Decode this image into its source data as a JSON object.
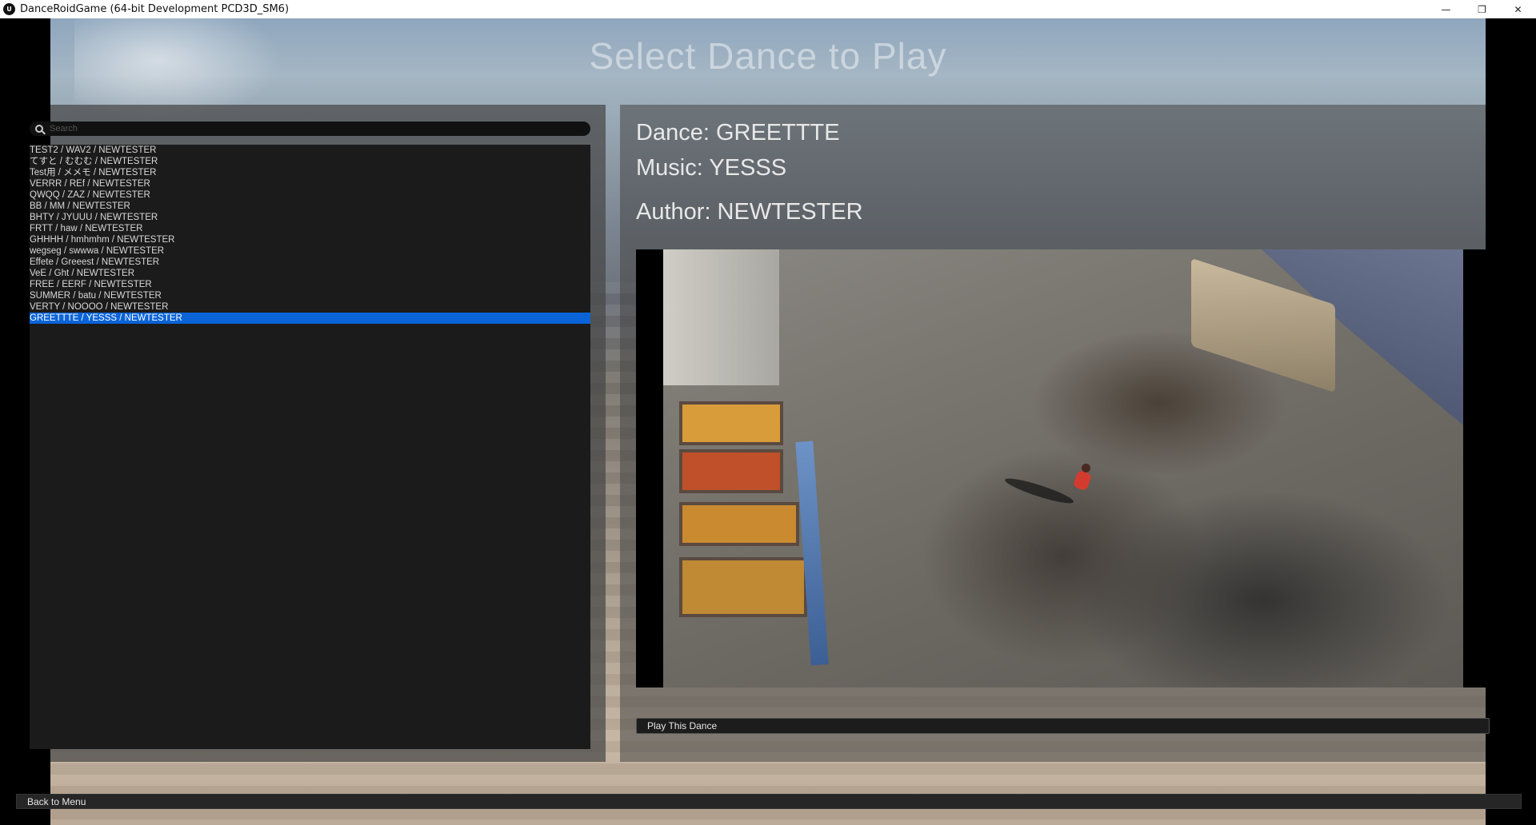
{
  "window": {
    "title": "DanceRoidGame (64-bit Development PCD3D_SM6)",
    "logo_text": "U",
    "controls": [
      "minimize",
      "restore",
      "close"
    ],
    "control_glyphs": {
      "minimize": "—",
      "restore": "❐",
      "close": "✕"
    }
  },
  "page": {
    "title": "Select Dance to Play"
  },
  "search": {
    "placeholder": "Search",
    "value": ""
  },
  "dance_list": {
    "items": [
      "TEST2 / WAV2 / NEWTESTER",
      "てすと / むむむ / NEWTESTER",
      "Test用 / メメモ / NEWTESTER",
      "VERRR / REf / NEWTESTER",
      "QWQQ / ZAZ / NEWTESTER",
      "BB / MM / NEWTESTER",
      "BHTY / JYUUU / NEWTESTER",
      "FRTT / haw / NEWTESTER",
      "GHHHH / hmhmhm / NEWTESTER",
      "wegseg / swwwa / NEWTESTER",
      "Effete / Greeest / NEWTESTER",
      "VeE / Ght / NEWTESTER",
      "FREE / EERF / NEWTESTER",
      "SUMMER / batu / NEWTESTER",
      "VERTY / NOOOO / NEWTESTER",
      "GREETTTE / YESSS / NEWTESTER"
    ],
    "selected_index": 15,
    "selection_color": "#0a64d8"
  },
  "details": {
    "dance": "Dance: GREETTTE",
    "music": "Music: YESSS",
    "author": "Author: NEWTESTER"
  },
  "buttons": {
    "play": "Play This Dance",
    "back": "Back to Menu"
  }
}
